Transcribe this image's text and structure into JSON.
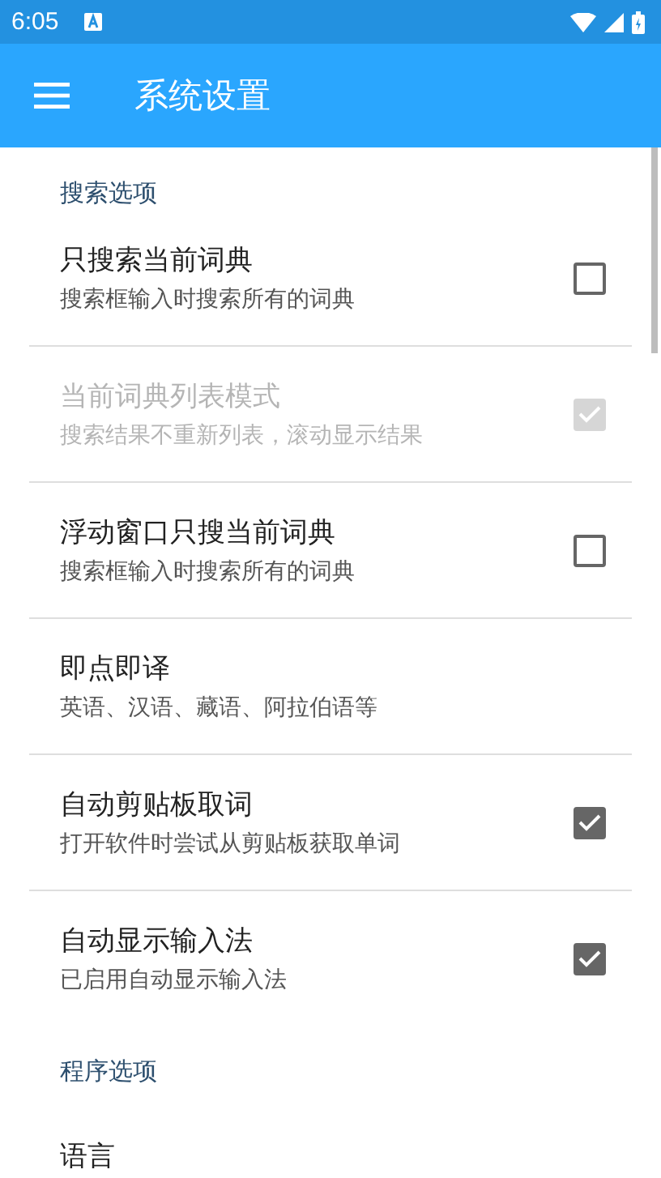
{
  "status_bar": {
    "time": "6:05"
  },
  "app_bar": {
    "title": "系统设置"
  },
  "sections": [
    {
      "header": "搜索选项",
      "items": [
        {
          "kind": "checkbox",
          "title": "只搜索当前词典",
          "summary": "搜索框输入时搜索所有的词典",
          "checked": false,
          "disabled": false
        },
        {
          "kind": "checkbox",
          "title": "当前词典列表模式",
          "summary": "搜索结果不重新列表，滚动显示结果",
          "checked": true,
          "disabled": true
        },
        {
          "kind": "checkbox",
          "title": "浮动窗口只搜当前词典",
          "summary": "搜索框输入时搜索所有的词典",
          "checked": false,
          "disabled": false
        },
        {
          "kind": "plain",
          "title": "即点即译",
          "summary": "英语、汉语、藏语、阿拉伯语等",
          "disabled": false
        },
        {
          "kind": "checkbox",
          "title": "自动剪贴板取词",
          "summary": "打开软件时尝试从剪贴板获取单词",
          "checked": true,
          "disabled": false
        },
        {
          "kind": "checkbox",
          "title": "自动显示输入法",
          "summary": "已启用自动显示输入法",
          "checked": true,
          "disabled": false
        }
      ]
    },
    {
      "header": "程序选项",
      "items": [
        {
          "kind": "plain",
          "title": "语言",
          "disabled": false
        }
      ]
    }
  ]
}
